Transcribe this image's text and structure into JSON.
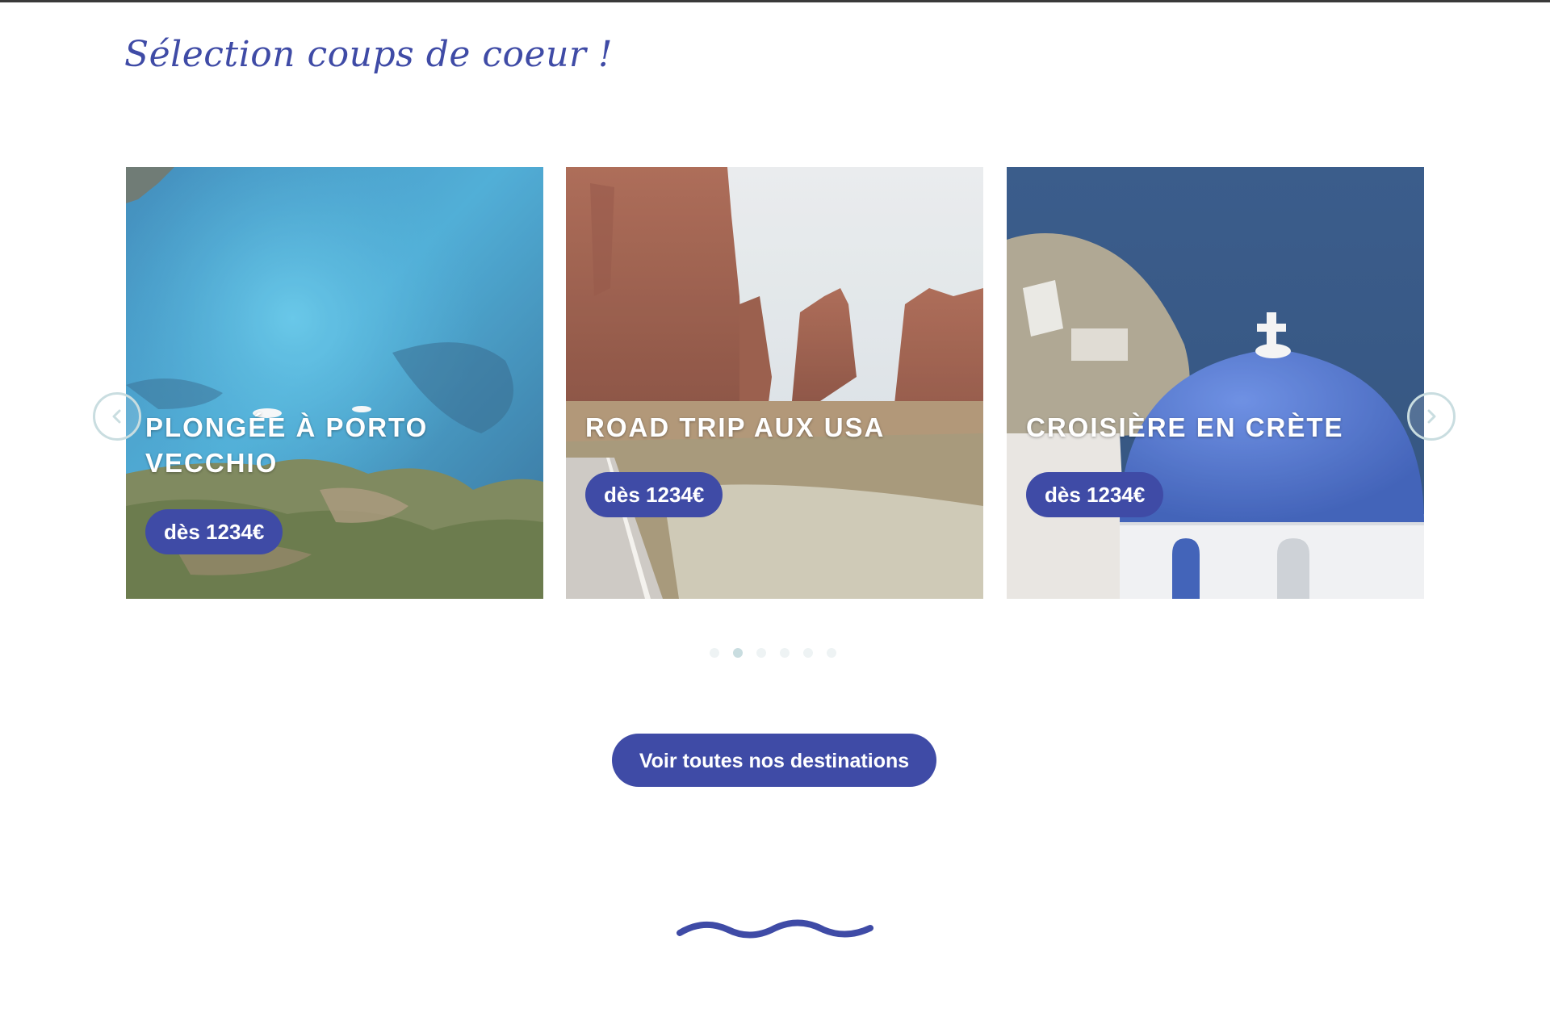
{
  "section": {
    "title": "Sélection coups de coeur !"
  },
  "carousel": {
    "prev_icon": "chevron-left-icon",
    "next_icon": "chevron-right-icon",
    "slides": [
      {
        "title": "PLONGÉE À PORTO VECCHIO",
        "price": "dès 1234€",
        "image": "turquoise sea bay seen from a rocky coast"
      },
      {
        "title": "ROAD TRIP AUX USA",
        "price": "dès 1234€",
        "image": "red rock canyon and desert road"
      },
      {
        "title": "CROISIÈRE EN CRÈTE",
        "price": "dès 1234€",
        "image": "blue domed chapel above the sea"
      }
    ],
    "pagination": {
      "count": 6,
      "active_index": 1
    }
  },
  "cta": {
    "label": "Voir toutes nos destinations"
  },
  "decoration": {
    "wave_icon": "wave-icon"
  },
  "colors": {
    "accent": "#3f4ba6",
    "arrow_border": "#c9dde0",
    "dot_inactive": "#eef3f4",
    "dot_active": "#c9dde0"
  }
}
